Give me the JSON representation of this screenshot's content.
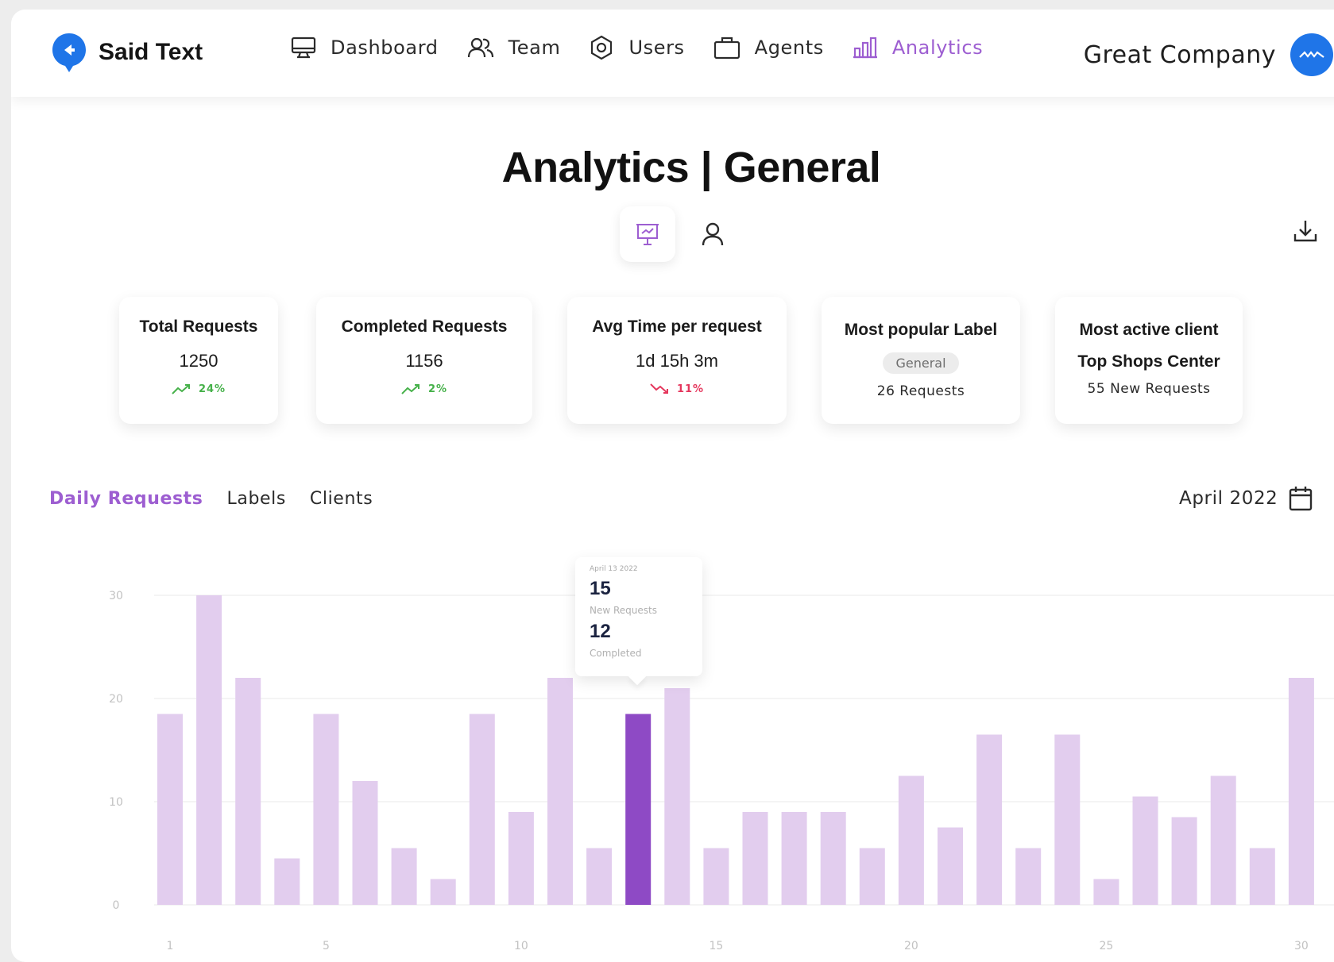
{
  "brand": {
    "name": "Said Text",
    "color": "#1f75e8"
  },
  "nav": {
    "items": [
      {
        "label": "Dashboard",
        "icon": "monitor-icon"
      },
      {
        "label": "Team",
        "icon": "team-icon"
      },
      {
        "label": "Users",
        "icon": "users-icon"
      },
      {
        "label": "Agents",
        "icon": "briefcase-icon"
      },
      {
        "label": "Analytics",
        "icon": "bar-chart-icon",
        "active": true
      }
    ]
  },
  "company": {
    "name": "Great Company"
  },
  "page": {
    "title": "Analytics | General"
  },
  "accent_color": "#9d5ed1",
  "stats": [
    {
      "title": "Total Requests",
      "value": "1250",
      "trend": "24%",
      "direction": "up"
    },
    {
      "title": "Completed Requests",
      "value": "1156",
      "trend": "2%",
      "direction": "up"
    },
    {
      "title": "Avg Time per request",
      "value": "1d 15h 3m",
      "trend": "11%",
      "direction": "down"
    },
    {
      "title": "Most popular Label",
      "badge": "General",
      "sub": "26 Requests"
    },
    {
      "title": "Most active client",
      "value": "Top Shops Center",
      "sub": "55 New Requests"
    }
  ],
  "chart_tabs": [
    {
      "label": "Daily Requests",
      "active": true
    },
    {
      "label": "Labels"
    },
    {
      "label": "Clients"
    }
  ],
  "month": "April 2022",
  "tooltip": {
    "date": "April 13 2022",
    "new_requests": "15",
    "new_requests_label": "New Requests",
    "completed": "12",
    "completed_label": "Completed"
  },
  "chart_data": {
    "type": "bar",
    "x": [
      1,
      2,
      3,
      4,
      5,
      6,
      7,
      8,
      9,
      10,
      11,
      12,
      13,
      14,
      15,
      16,
      17,
      18,
      19,
      20,
      21,
      22,
      23,
      24,
      25,
      26,
      27,
      28,
      29,
      30
    ],
    "values": [
      18.5,
      30,
      22,
      4.5,
      18.5,
      12,
      5.5,
      2.5,
      18.5,
      9,
      22,
      5.5,
      18.5,
      21,
      5.5,
      9,
      9,
      9,
      5.5,
      12.5,
      7.5,
      16.5,
      5.5,
      16.5,
      2.5,
      10.5,
      8.5,
      12.5,
      5.5,
      22
    ],
    "highlight_index": 12,
    "ylim": [
      0,
      30
    ],
    "yticks": [
      0,
      10,
      20,
      30
    ],
    "xticks": [
      1,
      5,
      10,
      15,
      20,
      25,
      30
    ],
    "bar_color": "#e2cdee",
    "highlight_color": "#8e4ac5",
    "grid": true
  }
}
